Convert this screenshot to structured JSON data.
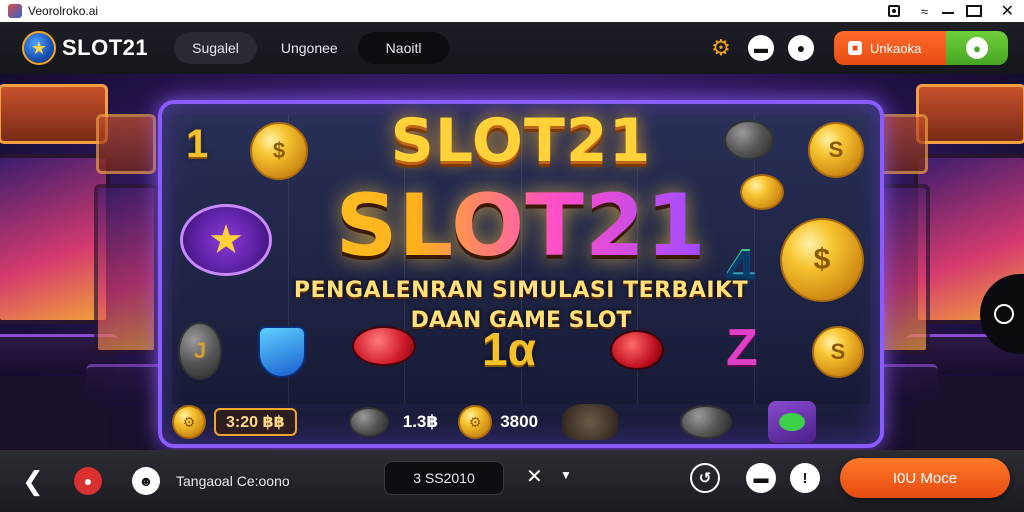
{
  "window": {
    "title": "Veorolroko.ai"
  },
  "nav": {
    "brand": "SLOT21",
    "tabs": [
      "Sugalel",
      "Ungonee",
      "Naoitl"
    ]
  },
  "actions": {
    "orange_button": "Unkaoka"
  },
  "game": {
    "logo_top": "SLOT21",
    "logo_main": "SLOT21",
    "tagline_line1": "PENGALENRAN SIMULASI TERBAIKT",
    "tagline_line2": "DAAN GAME SLOT",
    "reel_numbers": {
      "top_left": "1",
      "mid_right": "4",
      "bottom_center": "1α",
      "bottom_right": "Z",
      "bottom_left_coin": "J"
    },
    "payline": {
      "bet_box": "3:20 ฿฿",
      "value_one": "1.3฿",
      "value_two": "3800"
    }
  },
  "bottom": {
    "label": "Tangaoal Ce:oono",
    "field_value": "3 SS2010",
    "cta_label": "I0U Moce"
  }
}
